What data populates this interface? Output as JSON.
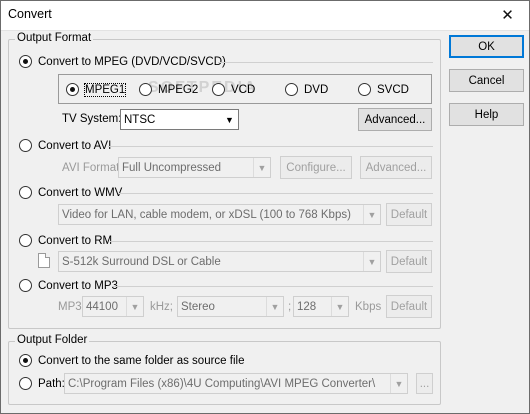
{
  "window": {
    "title": "Convert",
    "close_glyph": "✕"
  },
  "watermark": "SOFTPEDIA",
  "output_format": {
    "label": "Output Format",
    "mpeg": {
      "label": "Convert to MPEG (DVD/VCD/SVCD)",
      "options": [
        "MPEG1",
        "MPEG2",
        "VCD",
        "DVD",
        "SVCD"
      ],
      "tv_system_label": "TV System:",
      "tv_system_value": "NTSC",
      "advanced_label": "Advanced..."
    },
    "avi": {
      "label": "Convert to AVI",
      "format_label": "AVI Format:",
      "format_value": "Full Uncompressed",
      "configure_label": "Configure...",
      "advanced_label": "Advanced..."
    },
    "wmv": {
      "label": "Convert to WMV",
      "profile_value": "Video for LAN, cable modem, or xDSL (100 to 768 Kbps)",
      "default_label": "Default"
    },
    "rm": {
      "label": "Convert to RM",
      "profile_value": "S-512k Surround DSL or Cable",
      "default_label": "Default"
    },
    "mp3": {
      "label": "Convert to MP3",
      "mp3_label": "MP3",
      "rate_value": "44100",
      "khz_label": "kHz;",
      "channel_value": "Stereo",
      "separator": ";",
      "bitrate_value": "128",
      "kbps_label": "Kbps",
      "default_label": "Default"
    }
  },
  "output_folder": {
    "label": "Output Folder",
    "same_folder_label": "Convert to the same folder as source file",
    "path_label": "Path:",
    "path_value": "C:\\Program Files (x86)\\4U Computing\\AVI MPEG Converter\\",
    "browse_label": "..."
  },
  "buttons": {
    "ok": "OK",
    "cancel": "Cancel",
    "help": "Help"
  },
  "selected": {
    "format": "mpeg",
    "mpeg_option": "MPEG1",
    "folder": "same"
  }
}
